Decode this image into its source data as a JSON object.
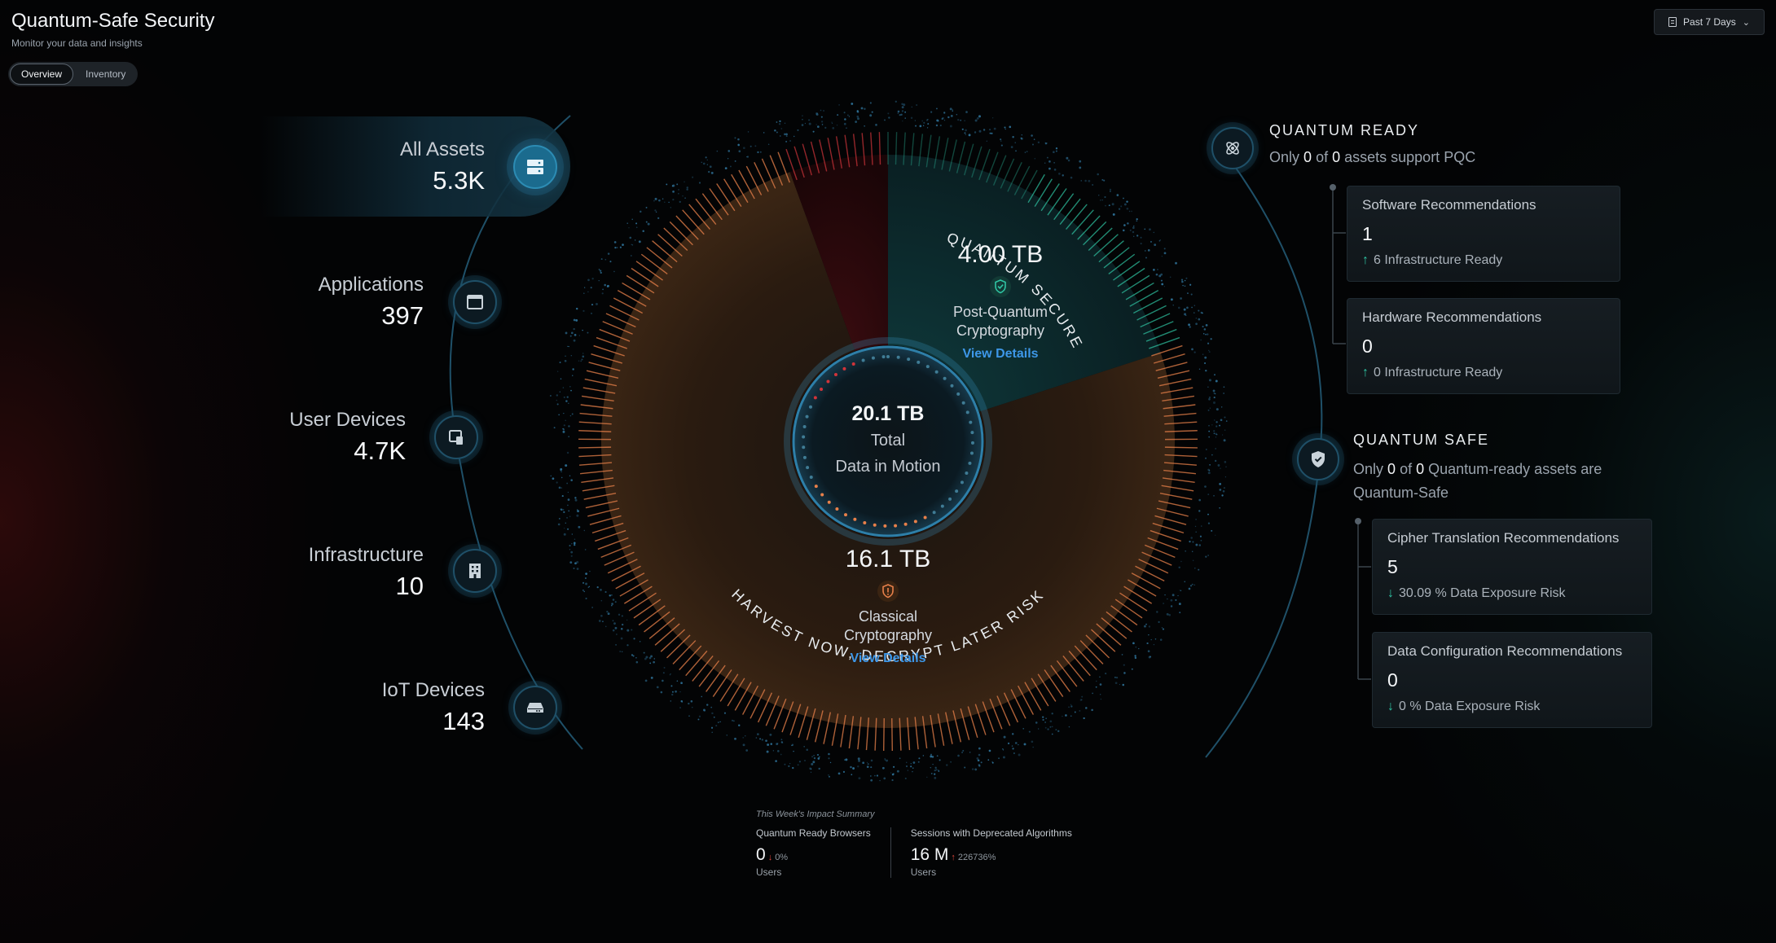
{
  "header": {
    "title": "Quantum-Safe Security",
    "subtitle": "Monitor your data and insights",
    "tabs": [
      {
        "label": "Overview"
      },
      {
        "label": "Inventory"
      }
    ],
    "date_range": "Past 7 Days"
  },
  "assets": [
    {
      "label": "All Assets",
      "value": "5.3K",
      "icon": "server-icon"
    },
    {
      "label": "Applications",
      "value": "397",
      "icon": "app-window-icon"
    },
    {
      "label": "User Devices",
      "value": "4.7K",
      "icon": "devices-icon"
    },
    {
      "label": "Infrastructure",
      "value": "10",
      "icon": "building-icon"
    },
    {
      "label": "IoT Devices",
      "value": "143",
      "icon": "hard-drive-icon"
    }
  ],
  "donut": {
    "total_value": "20.1 TB",
    "total_label_1": "Total",
    "total_label_2": "Data in Motion",
    "pq_value": "4.00 TB",
    "pq_label_1": "Post-Quantum",
    "pq_label_2": "Cryptography",
    "pq_link": "View Details",
    "classic_value": "16.1 TB",
    "classic_label_1": "Classical",
    "classic_label_2": "Cryptography",
    "classic_link": "View Details",
    "arc_top": "QUANTUM SECURE",
    "arc_bottom": "HARVEST NOW, DECRYPT LATER RISK",
    "colors": {
      "secure": "#2fc4a3",
      "risk": "#e8804a",
      "critical": "#d2343a"
    }
  },
  "quantum_ready": {
    "title": "QUANTUM READY",
    "desc_prefix": "Only",
    "count_a": "0",
    "desc_mid": "of",
    "count_b": "0",
    "desc_suffix": "assets support PQC",
    "cards": [
      {
        "title": "Software Recommendations",
        "value": "1",
        "footer": "6 Infrastructure Ready"
      },
      {
        "title": "Hardware Recommendations",
        "value": "0",
        "footer": "0 Infrastructure Ready"
      }
    ]
  },
  "quantum_safe": {
    "title": "QUANTUM SAFE",
    "desc_prefix": "Only",
    "count_a": "0",
    "desc_mid": "of",
    "count_b": "0",
    "desc_suffix": "Quantum-ready assets are Quantum-Safe",
    "cards": [
      {
        "title": "Cipher Translation Recommendations",
        "value": "5",
        "footer": "30.09 % Data Exposure Risk"
      },
      {
        "title": "Data Configuration Recommendations",
        "value": "0",
        "footer": "0 % Data Exposure Risk"
      }
    ]
  },
  "summary": {
    "title": "This Week's Impact Summary",
    "items": [
      {
        "label": "Quantum Ready Browsers",
        "value": "0",
        "delta": "0%",
        "unit": "Users"
      },
      {
        "label": "Sessions with Deprecated Algorithms",
        "value": "16 M",
        "delta": "226736%",
        "unit": "Users"
      }
    ]
  }
}
